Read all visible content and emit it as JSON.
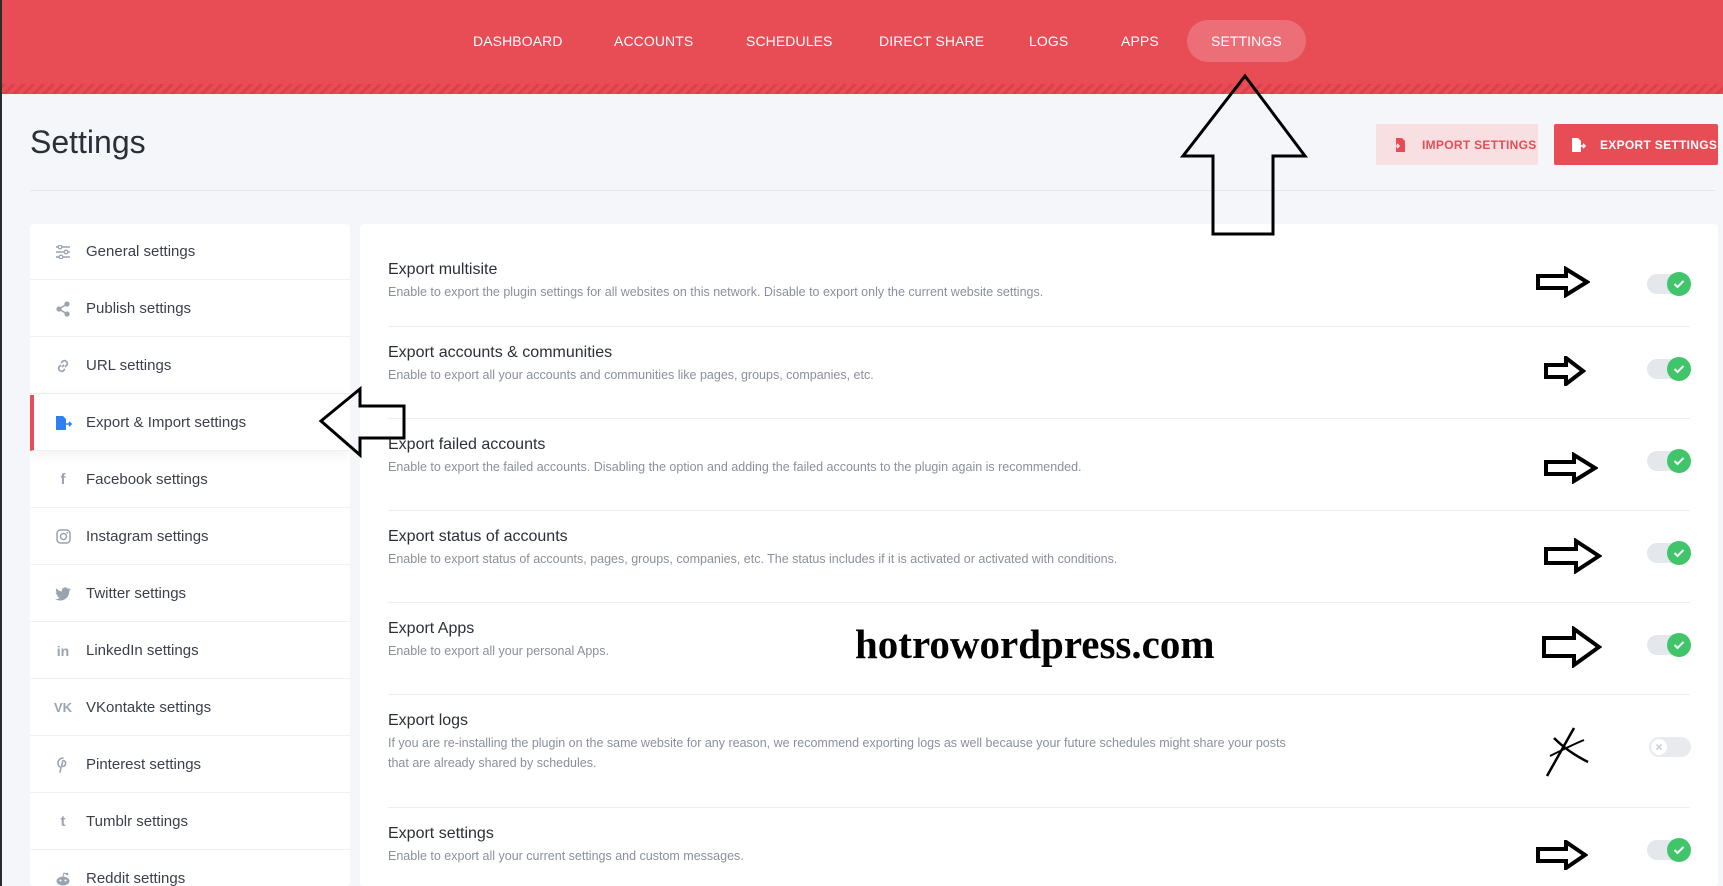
{
  "nav": {
    "items": [
      {
        "label": "DASHBOARD"
      },
      {
        "label": "ACCOUNTS"
      },
      {
        "label": "SCHEDULES"
      },
      {
        "label": "DIRECT SHARE"
      },
      {
        "label": "LOGS"
      },
      {
        "label": "APPS"
      },
      {
        "label": "SETTINGS",
        "active": true
      }
    ]
  },
  "header": {
    "title": "Settings",
    "import_label": "IMPORT SETTINGS",
    "export_label": "EXPORT SETTINGS"
  },
  "sidebar": {
    "items": [
      {
        "label": "General settings",
        "icon": "sliders-icon"
      },
      {
        "label": "Publish settings",
        "icon": "share-icon"
      },
      {
        "label": "URL settings",
        "icon": "link-icon"
      },
      {
        "label": "Export & Import settings",
        "icon": "file-export-icon",
        "active": true
      },
      {
        "label": "Facebook settings",
        "icon": "facebook-icon"
      },
      {
        "label": "Instagram settings",
        "icon": "instagram-icon"
      },
      {
        "label": "Twitter settings",
        "icon": "twitter-icon"
      },
      {
        "label": "LinkedIn settings",
        "icon": "linkedin-icon"
      },
      {
        "label": "VKontakte settings",
        "icon": "vk-icon"
      },
      {
        "label": "Pinterest settings",
        "icon": "pinterest-icon"
      },
      {
        "label": "Tumblr settings",
        "icon": "tumblr-icon"
      },
      {
        "label": "Reddit settings",
        "icon": "reddit-icon"
      }
    ]
  },
  "options": [
    {
      "title": "Export multisite",
      "desc": "Enable to export the plugin settings for all websites on this network. Disable to export only the current website settings.",
      "enabled": true
    },
    {
      "title": "Export accounts & communities",
      "desc": "Enable to export all your accounts and communities like pages, groups, companies, etc.",
      "enabled": true
    },
    {
      "title": "Export failed accounts",
      "desc": "Enable to export the failed accounts. Disabling the option and adding the failed accounts to the plugin again is recommended.",
      "enabled": true
    },
    {
      "title": "Export status of accounts",
      "desc": "Enable to export status of accounts, pages, groups, companies, etc. The status includes if it is activated or activated with conditions.",
      "enabled": true
    },
    {
      "title": "Export Apps",
      "desc": "Enable to export all your personal Apps.",
      "enabled": true
    },
    {
      "title": "Export logs",
      "desc": "If you are re-installing the plugin on the same website for any reason, we recommend exporting logs as well because your future schedules might share your posts that are already shared by schedules.",
      "enabled": false
    },
    {
      "title": "Export settings",
      "desc": "Enable to export all your current settings and custom messages.",
      "enabled": true
    }
  ],
  "watermark": "hotrowordpress.com",
  "colors": {
    "accent": "#e84c55",
    "toggle_on": "#41c56a",
    "background": "#f4f6f9"
  }
}
